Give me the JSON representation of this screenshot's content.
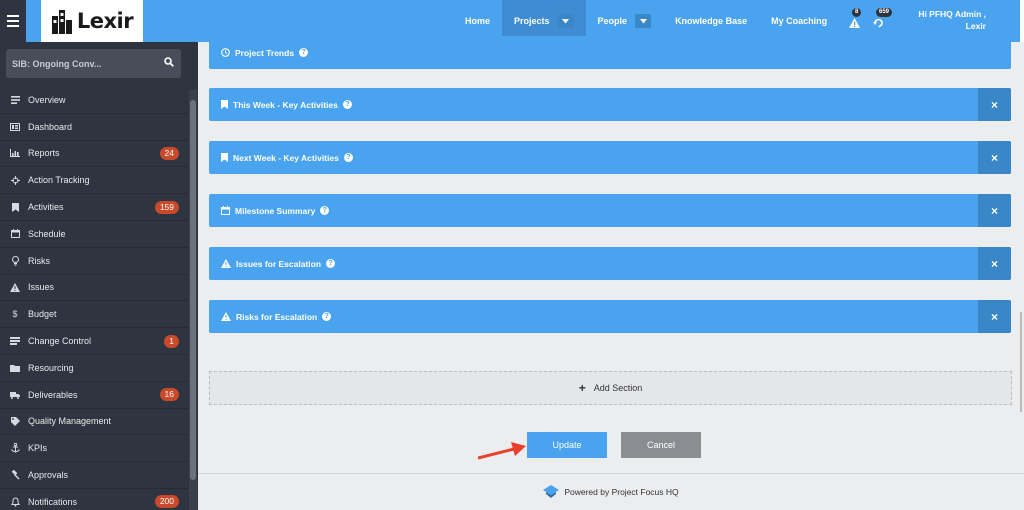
{
  "app": {
    "logo_text": "Lexir"
  },
  "nav": {
    "items": [
      {
        "label": "Home"
      },
      {
        "label": "Projects"
      },
      {
        "label": "People"
      },
      {
        "label": "Knowledge Base"
      },
      {
        "label": "My Coaching"
      }
    ],
    "alerts_count": "8",
    "notifications_count": "659",
    "greeting_line1": "Hi PFHQ Admin ,",
    "greeting_line2": "Lexir"
  },
  "sidebar": {
    "search_text": "SIB: Ongoing Conv...",
    "items": [
      {
        "label": "Overview",
        "icon": "list-icon",
        "count": ""
      },
      {
        "label": "Dashboard",
        "icon": "dashboard-icon",
        "count": ""
      },
      {
        "label": "Reports",
        "icon": "bar-chart-icon",
        "count": "24"
      },
      {
        "label": "Action Tracking",
        "icon": "crosshair-icon",
        "count": ""
      },
      {
        "label": "Activities",
        "icon": "bookmark-icon",
        "count": "159"
      },
      {
        "label": "Schedule",
        "icon": "calendar-icon",
        "count": ""
      },
      {
        "label": "Risks",
        "icon": "lightbulb-icon",
        "count": ""
      },
      {
        "label": "Issues",
        "icon": "warning-icon",
        "count": ""
      },
      {
        "label": "Budget",
        "icon": "dollar-icon",
        "count": ""
      },
      {
        "label": "Change Control",
        "icon": "change-icon",
        "count": "1"
      },
      {
        "label": "Resourcing",
        "icon": "folder-icon",
        "count": ""
      },
      {
        "label": "Deliverables",
        "icon": "truck-icon",
        "count": "16"
      },
      {
        "label": "Quality Management",
        "icon": "tag-icon",
        "count": ""
      },
      {
        "label": "KPIs",
        "icon": "anchor-icon",
        "count": ""
      },
      {
        "label": "Approvals",
        "icon": "gavel-icon",
        "count": ""
      },
      {
        "label": "Notifications",
        "icon": "bell-icon",
        "count": "200"
      }
    ]
  },
  "main": {
    "panels": [
      {
        "label": "Project Trends",
        "icon": "clock-icon",
        "removable": false
      },
      {
        "label": "This Week - Key Activities",
        "icon": "bookmark-icon",
        "removable": true
      },
      {
        "label": "Next Week - Key Activities",
        "icon": "bookmark-icon",
        "removable": true
      },
      {
        "label": "Milestone Summary",
        "icon": "calendar-icon",
        "removable": true
      },
      {
        "label": "Issues for Escalation",
        "icon": "warning-icon",
        "removable": true
      },
      {
        "label": "Risks for Escalation",
        "icon": "warning-icon",
        "removable": true
      }
    ],
    "add_section_label": "Add Section",
    "update_label": "Update",
    "cancel_label": "Cancel",
    "footer_text": "Powered by Project Focus HQ"
  },
  "colors": {
    "accent": "#4aa3ef",
    "sidebar": "#2f3540",
    "badge": "#c84a2a",
    "annotation_arrow": "#e8402a"
  }
}
